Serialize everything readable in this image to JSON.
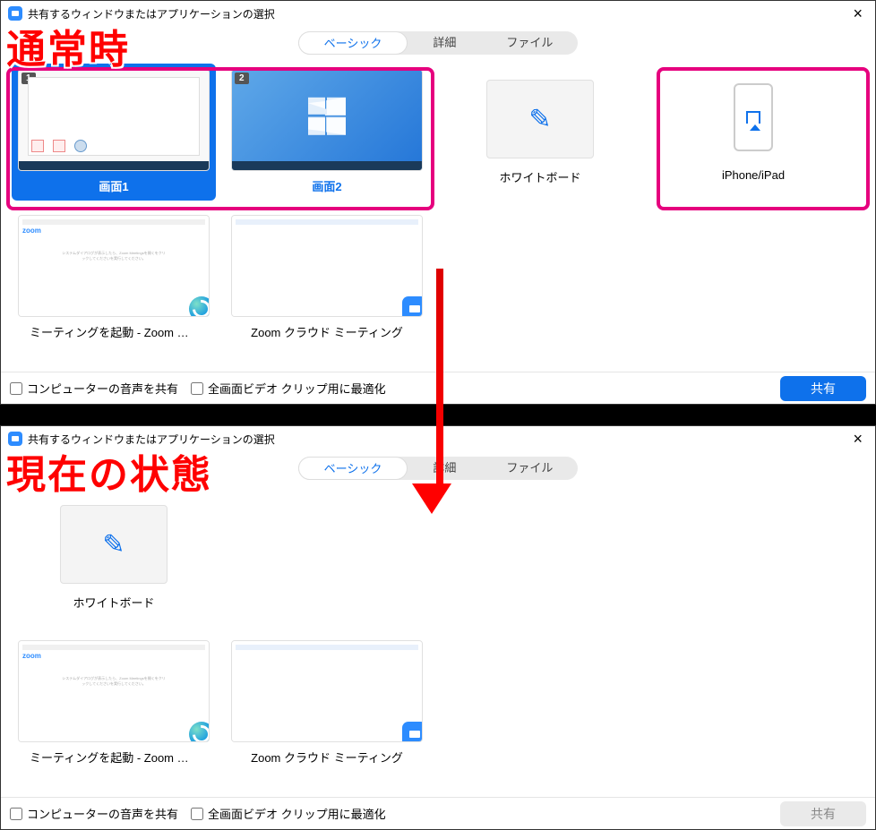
{
  "banners": {
    "normal": "通常時",
    "current": "現在の状態"
  },
  "window": {
    "title": "共有するウィンドウまたはアプリケーションの選択",
    "close": "×"
  },
  "tabs": {
    "basic": "ベーシック",
    "advanced": "詳細",
    "files": "ファイル"
  },
  "tiles": {
    "screen1_label": "画面1",
    "screen1_badge": "1",
    "screen2_label": "画面2",
    "screen2_badge": "2",
    "whiteboard_label": "ホワイトボード",
    "iphone_label": "iPhone/iPad",
    "app1_label": "ミーティングを起動 - Zoom および...",
    "app2_label": "Zoom クラウド ミーティング",
    "app1_logo": "zoom"
  },
  "footer": {
    "share_audio": "コンピューターの音声を共有",
    "optimize_video": "全画面ビデオ クリップ用に最適化",
    "share_button": "共有"
  }
}
